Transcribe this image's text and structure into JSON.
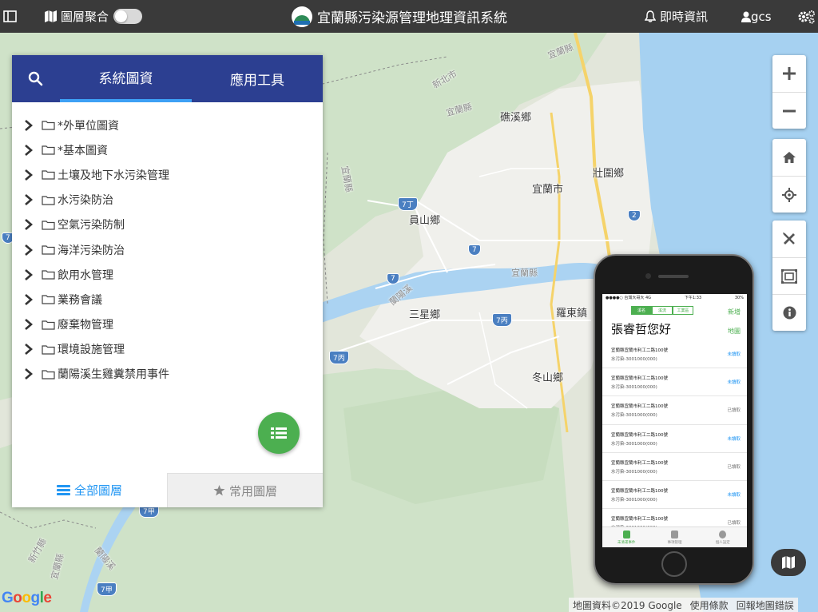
{
  "topbar": {
    "layer_merge_label": "圖層聚合",
    "system_title": "宜蘭縣污染源管理地理資訊系統",
    "realtime_label": "即時資訊",
    "user_label": "gcs"
  },
  "panel": {
    "tabs": [
      {
        "label": "系統圖資",
        "active": true
      },
      {
        "label": "應用工具",
        "active": false
      }
    ],
    "tree_items": [
      "*外單位圖資",
      "*基本圖資",
      "土壤及地下水污染管理",
      "水污染防治",
      "空氣污染防制",
      "海洋污染防治",
      "飲用水管理",
      "業務會議",
      "廢棄物管理",
      "環境設施管理",
      "蘭陽溪生雞糞禁用事件"
    ],
    "footer_tabs": {
      "all_layers": "全部圖層",
      "favorite_layers": "常用圖層"
    }
  },
  "map": {
    "towns": {
      "jiaoxi": "礁溪鄉",
      "yilan_city": "宜蘭市",
      "zhuangwei": "壯圍鄉",
      "yuanshan": "員山鄉",
      "yilan_county": "宜蘭縣",
      "sanxing": "三星鄉",
      "luodong": "羅東鎮",
      "dongshan": "冬山鄉",
      "new_taipei_1": "新北市",
      "new_taipei_2": "新竹縣",
      "yilan_county_2": "宜蘭縣",
      "yilan_county_3": "宜蘭縣",
      "yilan_county_4": "宜蘭縣",
      "yilan_county_5": "宜蘭縣",
      "lanyang_river": "蘭陽溪",
      "lanyang_river_2": "蘭陽溪",
      "yilan_county_6": "宜蘭縣"
    },
    "route_shields": [
      "7丁",
      "7",
      "7",
      "7丙",
      "7丙",
      "2",
      "7",
      "7甲",
      "7甲"
    ],
    "google_logo": "Google",
    "attribution": {
      "map_data": "地圖資料©2019 Google",
      "terms": "使用條款",
      "report": "回報地圖錯誤"
    },
    "colors": {
      "land": "#e4e7dc",
      "forest": "#cde3c5",
      "urban": "#f1f1f1",
      "water": "#a6d1f1",
      "river": "#abd3f2",
      "road_major": "#f9d76e",
      "road_minor": "#ffffff"
    }
  },
  "phone": {
    "status": {
      "left": "●●●●○ 台灣大哥大 4G",
      "time": "下午1:33",
      "right": "30%"
    },
    "segments": [
      {
        "label": "溪名",
        "active": true
      },
      {
        "label": "溪流",
        "active": false
      },
      {
        "label": "工業區",
        "active": false
      }
    ],
    "new_label": "新增",
    "greeting": "張睿哲您好",
    "map_label": "地圖",
    "list": [
      {
        "address": "宜蘭縣宜蘭市利工二路100號",
        "sub": "水污染-3001000(000)",
        "status": "未讀取",
        "unread": true
      },
      {
        "address": "宜蘭縣宜蘭市利工二路100號",
        "sub": "水污染-3001000(000)",
        "status": "未讀取",
        "unread": true
      },
      {
        "address": "宜蘭縣宜蘭市利工二路100號",
        "sub": "水污染-3001000(000)",
        "status": "已讀取",
        "unread": false
      },
      {
        "address": "宜蘭縣宜蘭市利工二路100號",
        "sub": "水污染-3001000(000)",
        "status": "未讀取",
        "unread": true
      },
      {
        "address": "宜蘭縣宜蘭市利工二路100號",
        "sub": "水污染-3001000(000)",
        "status": "已讀取",
        "unread": false
      },
      {
        "address": "宜蘭縣宜蘭市利工二路100號",
        "sub": "水污染-3001000(000)",
        "status": "未讀取",
        "unread": true
      },
      {
        "address": "宜蘭縣宜蘭市利工二路100號",
        "sub": "水污染-3001000(000)",
        "status": "已讀取",
        "unread": false
      }
    ],
    "tabs": [
      {
        "label": "未清運事件",
        "active": true
      },
      {
        "label": "事項管理",
        "active": false
      },
      {
        "label": "個人設定",
        "active": false
      }
    ]
  }
}
